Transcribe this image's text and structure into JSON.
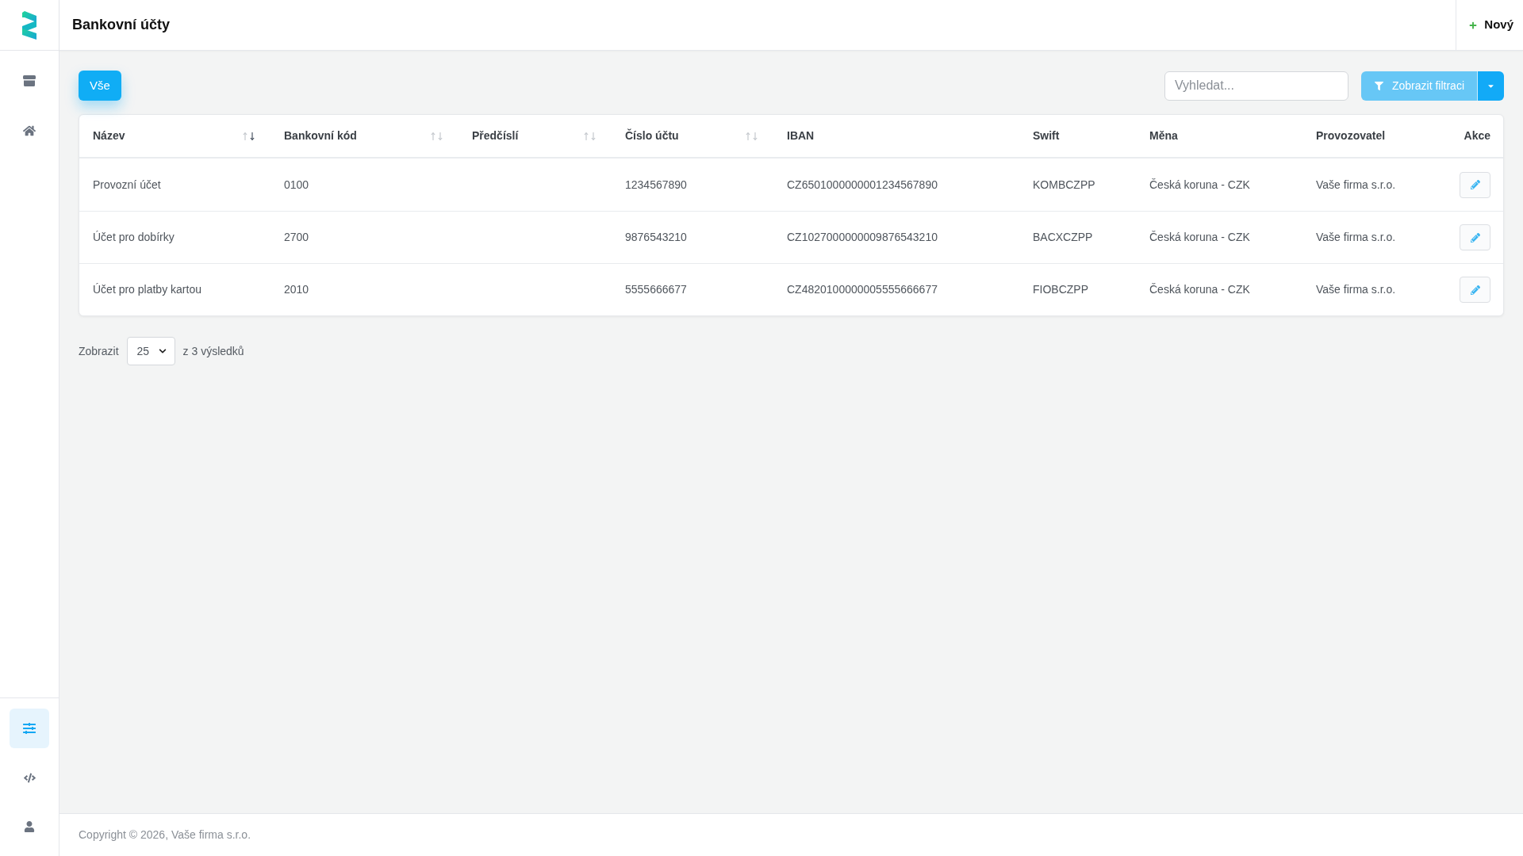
{
  "sidebar": {
    "top_items": [
      {
        "selected": false
      },
      {
        "selected": false
      }
    ],
    "bottom_items": [
      {
        "selected": true
      },
      {
        "selected": false
      },
      {
        "selected": false
      }
    ]
  },
  "header": {
    "title": "Bankovní účty",
    "new_button": {
      "label": "Nový"
    }
  },
  "toolbar": {
    "filters": [
      {
        "label": "Vše",
        "selected": true
      }
    ],
    "search": {
      "placeholder": "Vyhledat..."
    },
    "filter_button": {
      "label": "Zobrazit filtraci"
    }
  },
  "table": {
    "columns": [
      {
        "label": "Název",
        "sortable": true,
        "sorted": true,
        "descending": true
      },
      {
        "label": "Bankovní kód",
        "sortable": true,
        "sorted": false
      },
      {
        "label": "Předčíslí",
        "sortable": true,
        "sorted": false
      },
      {
        "label": "Číslo účtu",
        "sortable": true,
        "sorted": false
      },
      {
        "label": "IBAN",
        "sortable": false
      },
      {
        "label": "Swift",
        "sortable": false
      },
      {
        "label": "Měna",
        "sortable": false
      },
      {
        "label": "Provozovatel",
        "sortable": false
      },
      {
        "label": "Akce",
        "sortable": false
      }
    ],
    "rows": [
      {
        "name": "Provozní účet",
        "bank_code": "0100",
        "account_number": "1234567890",
        "iban": "CZ6501000000001234567890",
        "swift": "KOMBCZPP",
        "currency": "Česká koruna - CZK",
        "operator": "Vaše firma s.r.o."
      },
      {
        "name": "Účet pro dobírky",
        "bank_code": "2700",
        "account_number": "9876543210",
        "iban": "CZ1027000000009876543210",
        "swift": "BACXCZPP",
        "currency": "Česká koruna - CZK",
        "operator": "Vaše firma s.r.o."
      },
      {
        "name": "Účet pro platby kartou",
        "bank_code": "2010",
        "account_number": "5555666677",
        "iban": "CZ4820100000005555666677",
        "swift": "FIOBCZPP",
        "currency": "Česká koruna - CZK",
        "operator": "Vaše firma s.r.o."
      }
    ]
  },
  "pagination": {
    "label": "Zobrazit",
    "page_size": "25",
    "summary": "z 3 výsledků"
  },
  "footer": {
    "copyright": "Copyright © 2026, Vaše firma s.r.o."
  }
}
